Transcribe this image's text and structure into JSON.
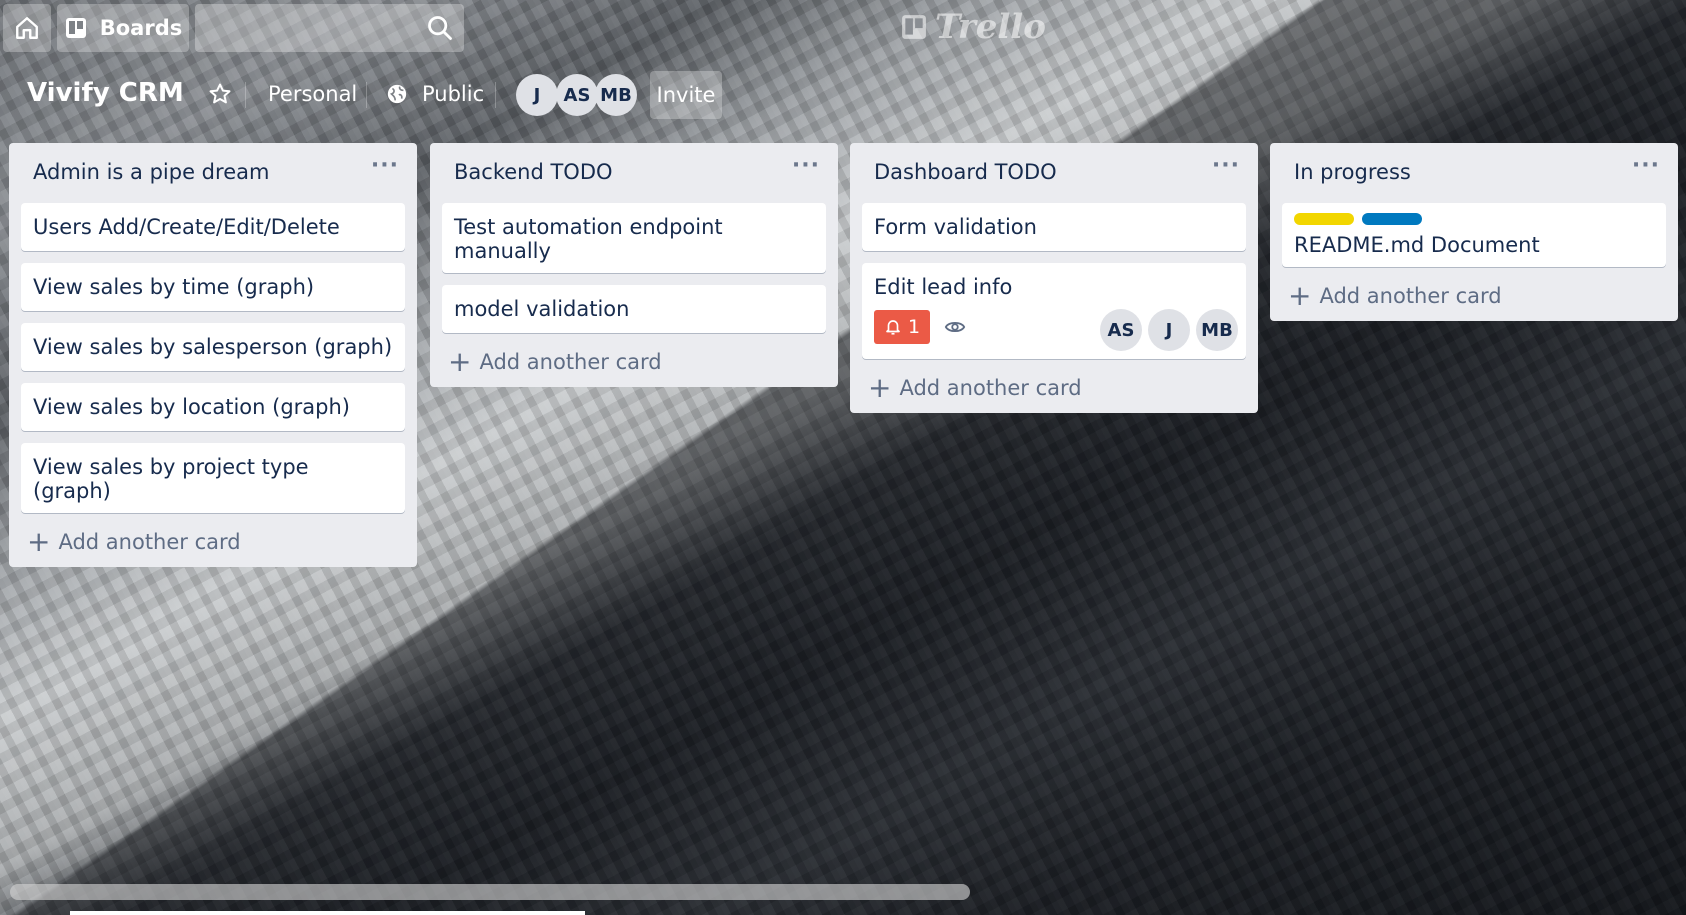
{
  "nav": {
    "home_icon": "home-icon",
    "boards_label": "Boards",
    "search_placeholder": "",
    "logo_text": "Trello"
  },
  "board": {
    "title": "Vivify CRM",
    "team_label": "Personal",
    "visibility_label": "Public",
    "members": [
      "J",
      "AS",
      "MB"
    ],
    "invite_label": "Invite"
  },
  "lists": [
    {
      "title": "Admin is a pipe dream",
      "menu": "···",
      "cards": [
        "Users Add/Create/Edit/Delete",
        "View sales by time (graph)",
        "View sales by salesperson (graph)",
        "View sales by location (graph)",
        "View sales by project type (graph)"
      ],
      "add_label": "Add another card"
    },
    {
      "title": "Backend TODO",
      "menu": "···",
      "cards": [
        "Test automation endpoint manually",
        "model validation"
      ],
      "add_label": "Add another card"
    },
    {
      "title": "Dashboard TODO",
      "menu": "···",
      "cards": [
        "Form validation",
        "Edit lead info"
      ],
      "card2_badge_count": "1",
      "card2_members": [
        "AS",
        "J",
        "MB"
      ],
      "add_label": "Add another card"
    },
    {
      "title": "In progress",
      "menu": "···",
      "cards": [
        "README.md Document"
      ],
      "label_colors": [
        "#f2d600",
        "#0079bf"
      ],
      "add_label": "Add another card"
    }
  ],
  "colors": {
    "due_badge": "#eb5a46",
    "list_bg": "#ebecf0"
  }
}
